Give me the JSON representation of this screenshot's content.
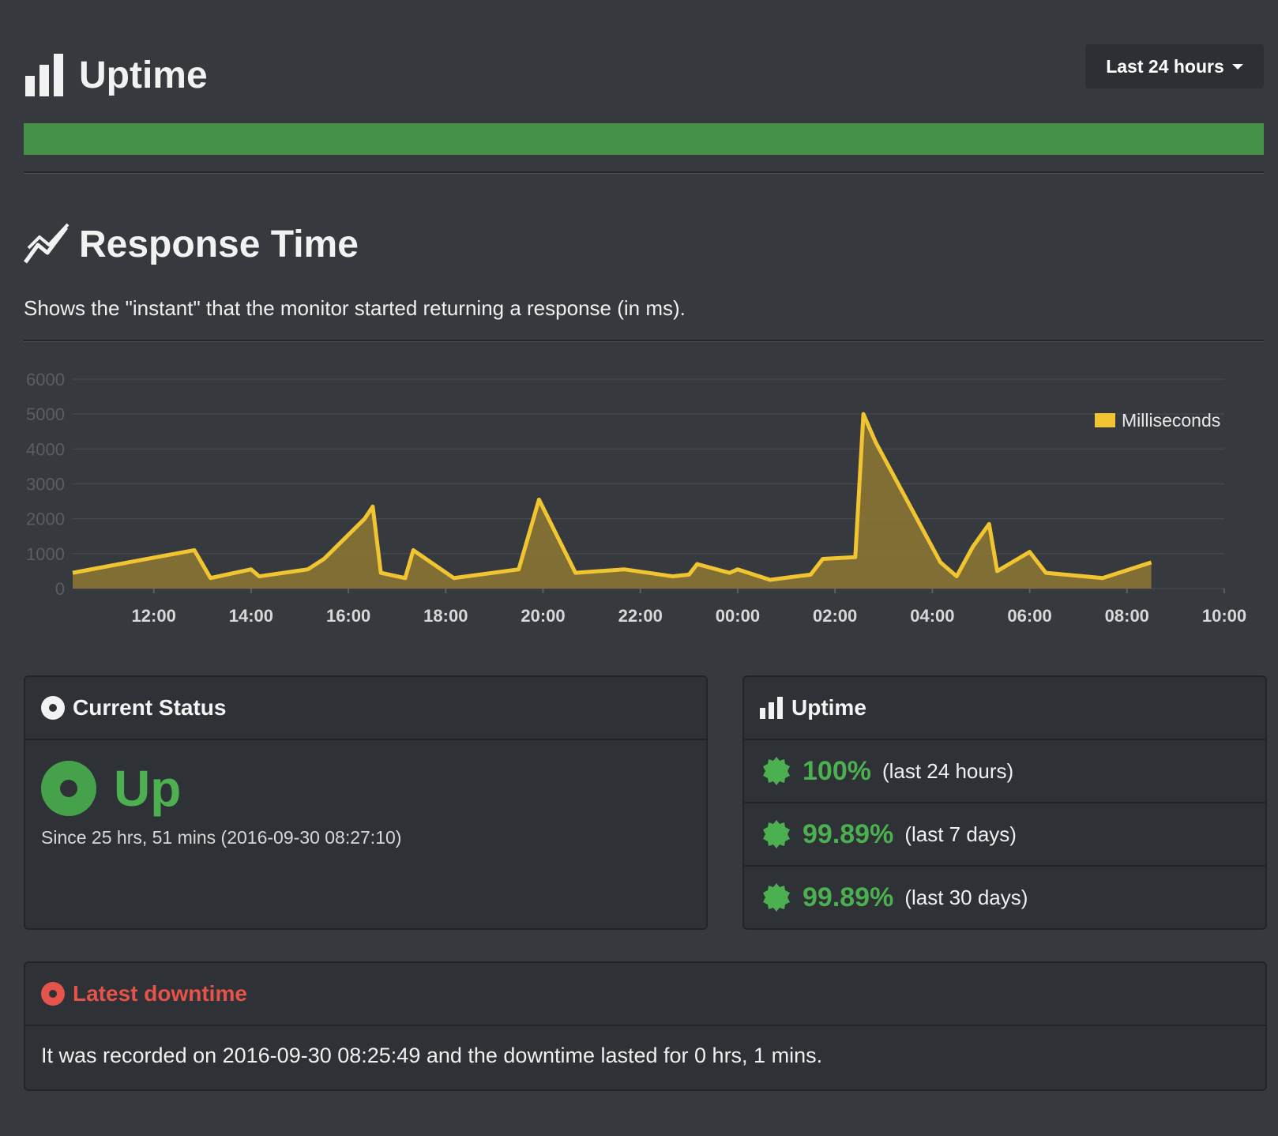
{
  "header": {
    "title": "Uptime",
    "range_label": "Last 24 hours",
    "uptime_bar_color": "#46904a"
  },
  "response_time": {
    "title": "Response Time",
    "description": "Shows the \"instant\" that the monitor started returning a response (in ms)."
  },
  "chart_data": {
    "type": "area",
    "x": [
      "10:20",
      "11:40",
      "12:50",
      "13:10",
      "14:00",
      "14:10",
      "15:10",
      "15:30",
      "16:20",
      "16:30",
      "16:40",
      "17:10",
      "17:20",
      "18:10",
      "19:30",
      "19:55",
      "20:40",
      "21:40",
      "22:40",
      "23:00",
      "23:10",
      "23:50",
      "24:00",
      "24:40",
      "25:30",
      "25:45",
      "26:25",
      "26:35",
      "26:50",
      "28:10",
      "28:30",
      "28:50",
      "29:10",
      "29:20",
      "30:00",
      "30:20",
      "31:30",
      "32:30"
    ],
    "series": [
      {
        "name": "Milliseconds",
        "color": "#f0c531",
        "values": [
          450,
          800,
          1100,
          300,
          550,
          350,
          550,
          850,
          2000,
          2350,
          450,
          300,
          1100,
          300,
          550,
          2550,
          450,
          550,
          350,
          400,
          700,
          450,
          550,
          250,
          400,
          850,
          900,
          5000,
          4200,
          750,
          350,
          1200,
          1850,
          500,
          1050,
          450,
          300,
          750
        ]
      }
    ],
    "ylim": [
      0,
      6000
    ],
    "yticks": [
      0,
      1000,
      2000,
      3000,
      4000,
      5000,
      6000
    ],
    "xticks": [
      "12:00",
      "14:00",
      "16:00",
      "18:00",
      "20:00",
      "22:00",
      "00:00",
      "02:00",
      "04:00",
      "06:00",
      "08:00",
      "10:00"
    ],
    "xlim": [
      "10:20",
      "34:00"
    ],
    "legend": "Milliseconds",
    "legend_position": "top-right",
    "grid": true
  },
  "current_status": {
    "heading": "Current Status",
    "status": "Up",
    "since": "Since 25 hrs, 51 mins (2016-09-30 08:27:10)",
    "status_color": "#4caf50"
  },
  "uptime_panel": {
    "heading": "Uptime",
    "rows": [
      {
        "percent": "100%",
        "period": "(last 24 hours)"
      },
      {
        "percent": "99.89%",
        "period": "(last 7 days)"
      },
      {
        "percent": "99.89%",
        "period": "(last 30 days)"
      }
    ]
  },
  "downtime": {
    "heading": "Latest downtime",
    "text": "It was recorded on 2016-09-30 08:25:49 and the downtime lasted for 0 hrs, 1 mins.",
    "color": "#e5534b"
  }
}
